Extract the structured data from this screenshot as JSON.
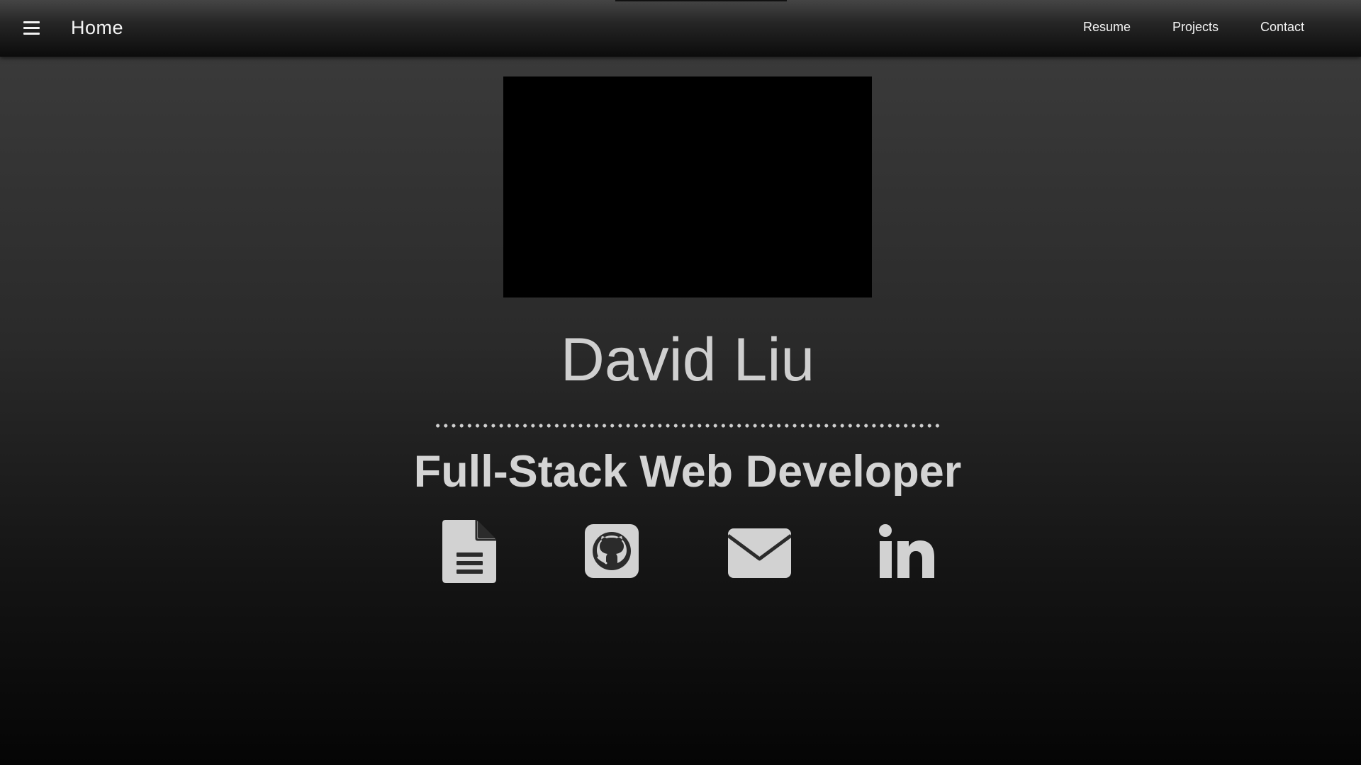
{
  "navbar": {
    "brand": "Home",
    "links": [
      {
        "label": "Resume"
      },
      {
        "label": "Projects"
      },
      {
        "label": "Contact"
      }
    ]
  },
  "hero": {
    "name": "David Liu",
    "title": "Full-Stack Web Developer"
  },
  "social_icons": [
    "document-icon",
    "github-icon",
    "email-icon",
    "linkedin-icon"
  ],
  "colors": {
    "text_light": "#cfcfcf",
    "nav_text": "#f4f4f4",
    "image_placeholder": "#000000"
  }
}
